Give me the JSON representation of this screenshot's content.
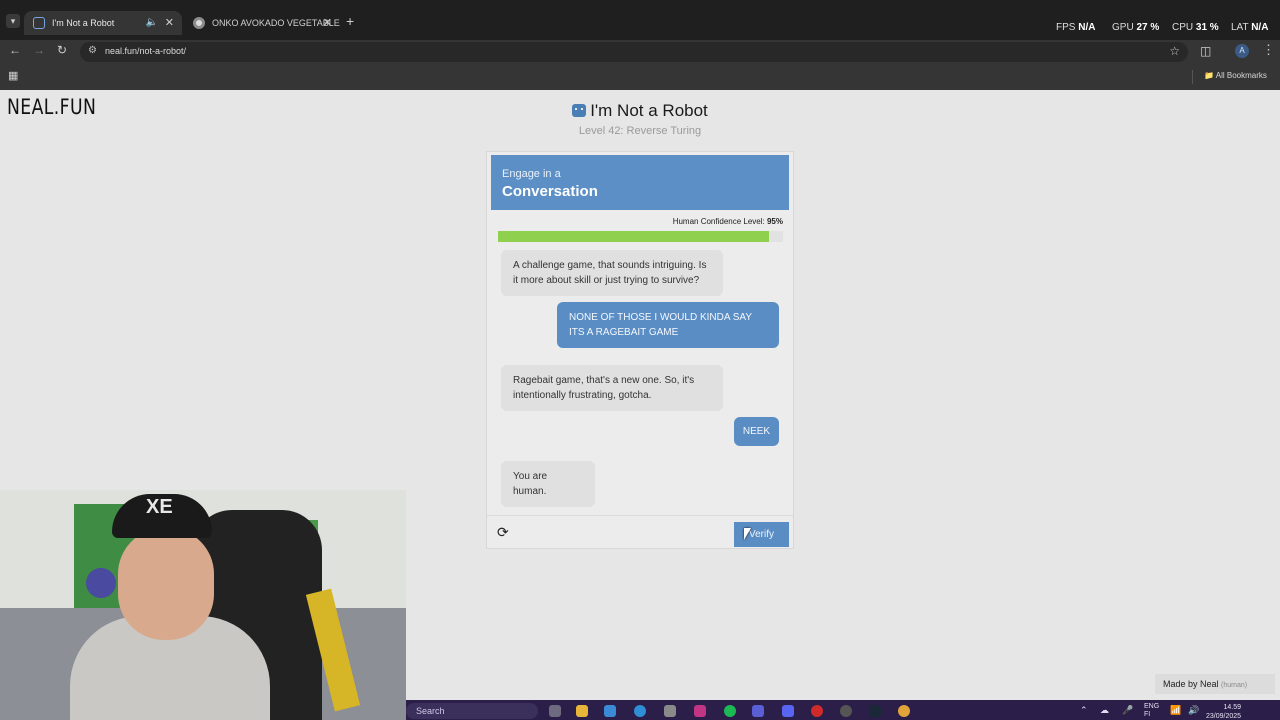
{
  "browser": {
    "tabs": [
      {
        "title": "I'm Not a Robot",
        "audio_icon": "speaker-icon",
        "active": true
      },
      {
        "title": "ONKO AVOKADO VEGETABLE -",
        "active": false
      }
    ],
    "new_tab": "+",
    "url": "neal.fun/not-a-robot/",
    "bookmarks_label": "All Bookmarks",
    "profile_initial": "A",
    "overlay_stats": {
      "fps_label": "FPS",
      "fps_value": "N/A",
      "gpu_label": "GPU",
      "gpu_value": "27 %",
      "cpu_label": "CPU",
      "cpu_value": "31 %",
      "lat_label": "LAT",
      "lat_value": "N/A"
    }
  },
  "page": {
    "logo": "NEAL.FUN",
    "title": "I'm Not a Robot",
    "subtitle": "Level 42: Reverse Turing",
    "made_by": "Made by Neal",
    "made_by_note": "(human)"
  },
  "captcha": {
    "banner_small": "Engage in a",
    "banner_big": "Conversation",
    "confidence_label": "Human Confidence Level:",
    "confidence_value": "95%",
    "confidence_fraction": 0.95,
    "messages": [
      {
        "from": "bot",
        "text": "A challenge game, that sounds intriguing. Is it more about skill or just trying to survive?"
      },
      {
        "from": "user",
        "text": "NONE OF THOSE I WOULD KINDA SAY ITS A RAGEBAIT GAME"
      },
      {
        "from": "bot",
        "text": "Ragebait game, that's a new one. So, it's intentionally frustrating, gotcha."
      },
      {
        "from": "user",
        "text": "NEEK"
      },
      {
        "from": "bot",
        "text": "You are human."
      }
    ],
    "verify_label": "Verify",
    "accent_color": "#5a8dc4",
    "bar_color": "#8fd14f"
  },
  "taskbar": {
    "search_placeholder": "Search",
    "language": "ENG",
    "language_sub": "FI",
    "time": "14.59",
    "date": "23/09/2025"
  }
}
